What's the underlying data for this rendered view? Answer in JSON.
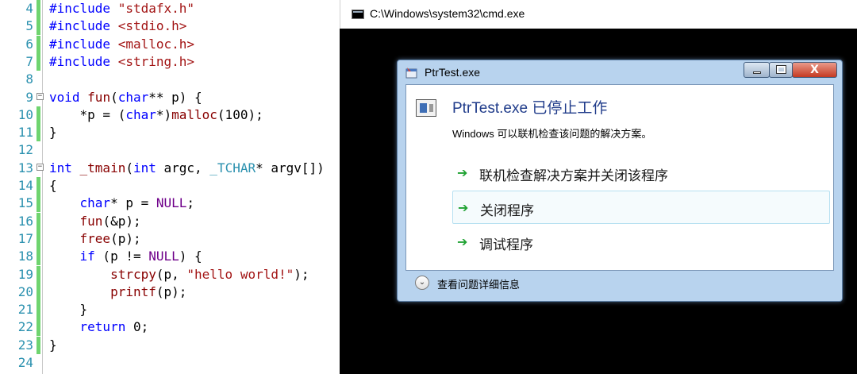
{
  "editor": {
    "lines": [
      {
        "no": "4",
        "code": [
          [
            "k",
            "#include "
          ],
          [
            "s",
            "\"stdafx.h\""
          ]
        ]
      },
      {
        "no": "5",
        "code": [
          [
            "k",
            "#include "
          ],
          [
            "s",
            "<stdio.h>"
          ]
        ]
      },
      {
        "no": "6",
        "code": [
          [
            "k",
            "#include "
          ],
          [
            "s",
            "<malloc.h>"
          ]
        ]
      },
      {
        "no": "7",
        "code": [
          [
            "k",
            "#include "
          ],
          [
            "s",
            "<string.h>"
          ]
        ]
      },
      {
        "no": "8",
        "code": []
      },
      {
        "no": "9",
        "code": [
          [
            "k",
            "void "
          ],
          [
            "f",
            "fun"
          ],
          [
            "n",
            "("
          ],
          [
            "k",
            "char"
          ],
          [
            "n",
            "** "
          ],
          [
            "n",
            "p) {"
          ]
        ]
      },
      {
        "no": "10",
        "code": [
          [
            "n",
            "    *p = ("
          ],
          [
            "k",
            "char"
          ],
          [
            "n",
            "*)"
          ],
          [
            "f",
            "malloc"
          ],
          [
            "n",
            "(100);"
          ]
        ]
      },
      {
        "no": "11",
        "code": [
          [
            "n",
            "}"
          ]
        ]
      },
      {
        "no": "12",
        "code": []
      },
      {
        "no": "13",
        "code": [
          [
            "k",
            "int "
          ],
          [
            "f",
            "_tmain"
          ],
          [
            "n",
            "("
          ],
          [
            "k",
            "int "
          ],
          [
            "n",
            "argc, "
          ],
          [
            "t",
            "_TCHAR"
          ],
          [
            "n",
            "* argv[])"
          ]
        ]
      },
      {
        "no": "14",
        "code": [
          [
            "n",
            "{"
          ]
        ]
      },
      {
        "no": "15",
        "code": [
          [
            "n",
            "    "
          ],
          [
            "k",
            "char"
          ],
          [
            "n",
            "* p = "
          ],
          [
            "m",
            "NULL"
          ],
          [
            "n",
            ";"
          ]
        ]
      },
      {
        "no": "16",
        "code": [
          [
            "n",
            "    "
          ],
          [
            "f",
            "fun"
          ],
          [
            "n",
            "(&p);"
          ]
        ]
      },
      {
        "no": "17",
        "code": [
          [
            "n",
            "    "
          ],
          [
            "f",
            "free"
          ],
          [
            "n",
            "(p);"
          ]
        ]
      },
      {
        "no": "18",
        "code": [
          [
            "n",
            "    "
          ],
          [
            "k",
            "if"
          ],
          [
            "n",
            " (p != "
          ],
          [
            "m",
            "NULL"
          ],
          [
            "n",
            ") {"
          ]
        ]
      },
      {
        "no": "19",
        "code": [
          [
            "n",
            "        "
          ],
          [
            "f",
            "strcpy"
          ],
          [
            "n",
            "(p, "
          ],
          [
            "s",
            "\"hello world!\""
          ],
          [
            "n",
            ");"
          ]
        ]
      },
      {
        "no": "20",
        "code": [
          [
            "n",
            "        "
          ],
          [
            "f",
            "printf"
          ],
          [
            "n",
            "(p);"
          ]
        ]
      },
      {
        "no": "21",
        "code": [
          [
            "n",
            "    }"
          ]
        ]
      },
      {
        "no": "22",
        "code": [
          [
            "n",
            "    "
          ],
          [
            "k",
            "return"
          ],
          [
            "n",
            " 0;"
          ]
        ]
      },
      {
        "no": "23",
        "code": [
          [
            "n",
            "}"
          ]
        ]
      },
      {
        "no": "24",
        "code": []
      }
    ]
  },
  "cmd": {
    "title": "C:\\Windows\\system32\\cmd.exe"
  },
  "dialog": {
    "title": "PtrTest.exe",
    "close_symbol": "X",
    "heading": "PtrTest.exe 已停止工作",
    "subtitle": "Windows 可以联机检查该问题的解决方案。",
    "options": [
      "联机检查解决方案并关闭该程序",
      "关闭程序",
      "调试程序"
    ],
    "details": "查看问题详细信息"
  },
  "colors": {
    "keyword": "#0000ff",
    "string": "#a31515",
    "function": "#880000",
    "line_number": "#2b91af",
    "cmd_bg": "#000000",
    "dialog_heading": "#1f3b8a",
    "arrow": "#1fa232"
  }
}
